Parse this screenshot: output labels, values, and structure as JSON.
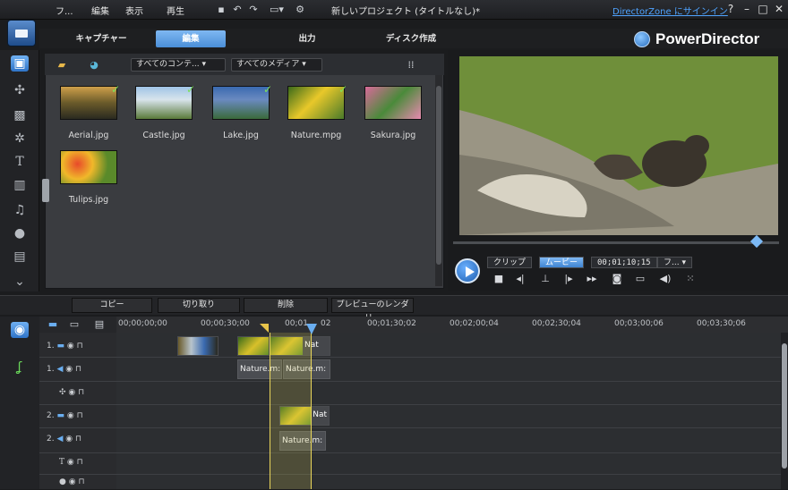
{
  "menu": {
    "items": [
      "フ...",
      "編集",
      "表示",
      "再生"
    ]
  },
  "project_title": "新しいプロジェクト (タイトルなし)*",
  "signin_link": "DirectorZone にサインイン",
  "window_controls": {
    "help": "?",
    "minimize": "–",
    "maximize": "□",
    "close": "✕"
  },
  "modes": {
    "capture": "キャプチャー",
    "edit": "編集",
    "produce": "出力",
    "disc": "ディスク作成"
  },
  "brand": "PowerDirector",
  "library": {
    "filter_content": "すべてのコンテ... ▾",
    "filter_media": "すべてのメディア ▾",
    "items": [
      {
        "name": "Aerial.jpg"
      },
      {
        "name": "Castle.jpg"
      },
      {
        "name": "Lake.jpg"
      },
      {
        "name": "Nature.mpg"
      },
      {
        "name": "Sakura.jpg"
      },
      {
        "name": "Tulips.jpg"
      }
    ]
  },
  "preview": {
    "clip_label": "クリップ",
    "movie_label": "ムービー",
    "timecode": "00;01;10;15",
    "format_label": "フ... ▾"
  },
  "edit_toolbar": {
    "copy": "コピー",
    "cut": "切り取り",
    "delete": "削除",
    "render": "プレビューのレンダリ..."
  },
  "timeline": {
    "ticks": [
      "00;00;00;00",
      "00;00;30;00",
      "00;01",
      "02",
      "00;01;30;02",
      "00;02;00;04",
      "00;02;30;04",
      "00;03;00;06",
      "00;03;30;06"
    ],
    "tracks": [
      "1.",
      "1.",
      "",
      "2.",
      "2.",
      "",
      ""
    ],
    "clips": {
      "video_a": "Nat",
      "audio_a": "Nature.m:",
      "audio_b": "Nature.m:",
      "video_2": "Nat",
      "audio_2": "Nature.m:"
    }
  }
}
